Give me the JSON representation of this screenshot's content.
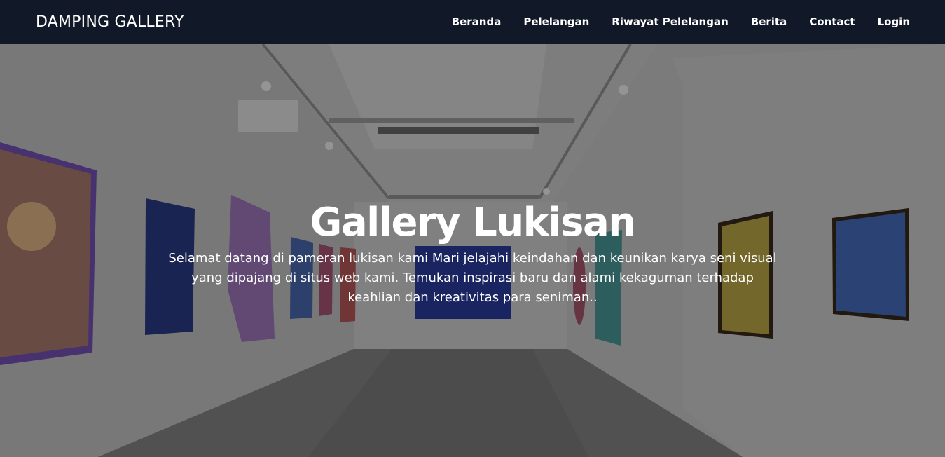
{
  "navbar": {
    "brand": "DAMPING GALLERY",
    "links": [
      {
        "label": "Beranda"
      },
      {
        "label": "Pelelangan"
      },
      {
        "label": "Riwayat Pelelangan"
      },
      {
        "label": "Berita"
      },
      {
        "label": "Contact"
      },
      {
        "label": "Login"
      }
    ],
    "background": "#111827"
  },
  "hero": {
    "title": "Gallery Lukisan",
    "subtitle": "Selamat datang di pameran lukisan kami Mari jelajahi keindahan dan keunikan karya seni visual yang dipajang di situs web kami. Temukan inspirasi baru dan alami kekaguman terhadap keahlian dan kreativitas para seniman..",
    "background_image": "art-gallery-hallway-photo"
  }
}
